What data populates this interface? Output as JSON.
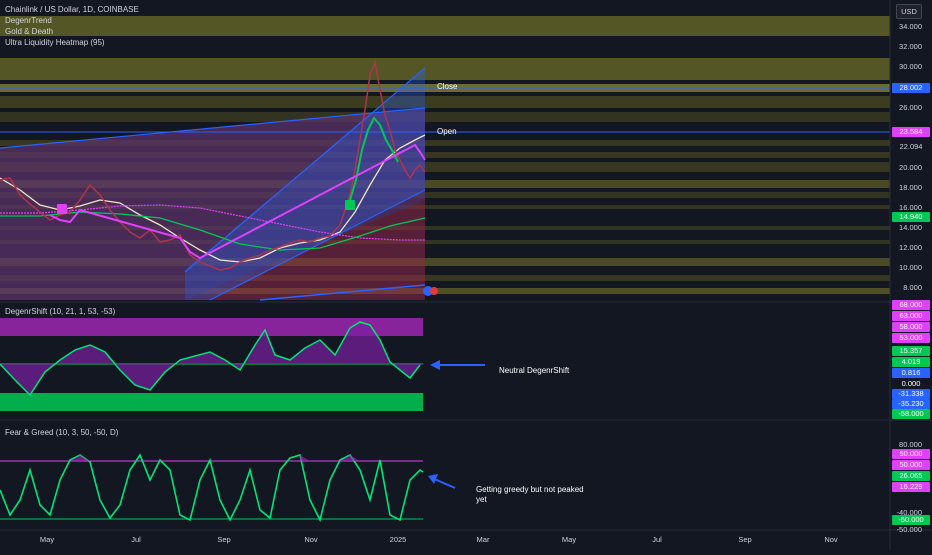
{
  "header": {
    "symbol_line": "Chainlink / US Dollar, 1D, COINBASE",
    "indicators": [
      "DegenrTrend",
      "Gold & Death",
      "Ultra Liquidity Heatmap (95)"
    ]
  },
  "currency_button": "USD",
  "price_axis": {
    "ticks": [
      "34.000",
      "32.000",
      "30.000",
      "28.000",
      "26.000",
      "24.000",
      "22.000",
      "20.000",
      "18.000",
      "16.000",
      "14.000",
      "12.000",
      "10.000",
      "8.000"
    ],
    "tags": [
      {
        "label": "28.002",
        "color": "#2962ff"
      },
      {
        "label": "23.584",
        "color": "#e040fb"
      },
      {
        "label": "22.094",
        "color": "#131722"
      },
      {
        "label": "14.940",
        "color": "#00c853"
      }
    ]
  },
  "price_lines": {
    "close_label": "Close",
    "open_label": "Open"
  },
  "degenshift": {
    "title": "DegenrShift (10, 21, 1, 53, -53)",
    "ticks": [
      "68.000",
      "63.000",
      "58.000",
      "53.000",
      "15.357",
      "4.019",
      "0.816",
      "0.000",
      "-31.338",
      "-35.230",
      "-58.000"
    ],
    "annotation": "Neutral DegenrShift"
  },
  "fear_greed": {
    "title": "Fear & Greed (10, 3, 50, -50, D)",
    "ticks": [
      "80.000",
      "50.000",
      "50.000",
      "26.065",
      "16.229",
      "-40.000",
      "-50.000",
      "-50.000"
    ],
    "annotation_line1": "Getting greedy but not peaked",
    "annotation_line2": "yet"
  },
  "time_axis": [
    "May",
    "Jul",
    "Sep",
    "Nov",
    "2025",
    "Mar",
    "May",
    "Jul",
    "Sep",
    "Nov"
  ],
  "colors": {
    "background": "#131722",
    "blue": "#2962ff",
    "magenta": "#e040fb",
    "green": "#00c853",
    "heatmap_yellow": "#a8a53b"
  }
}
